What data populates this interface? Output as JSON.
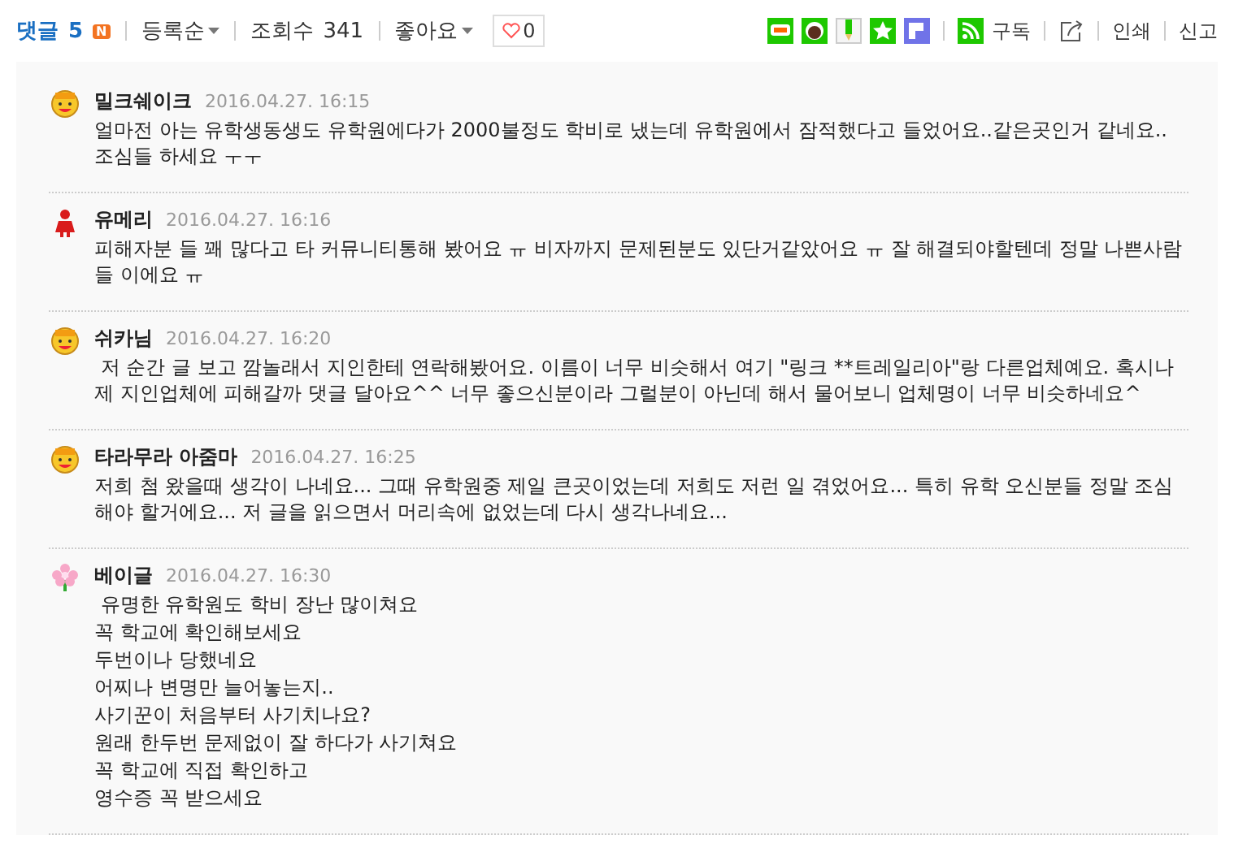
{
  "toolbar": {
    "comments_label": "댓글",
    "comments_count": "5",
    "new_badge": "N",
    "sort": "등록순",
    "views_label": "조회수",
    "views_count": "341",
    "likes_menu": "좋아요",
    "like_count": "0",
    "liked": false,
    "share_icons": [
      {
        "kind": "blog"
      },
      {
        "kind": "circle"
      },
      {
        "kind": "memo"
      },
      {
        "kind": "star"
      },
      {
        "kind": "pin"
      }
    ],
    "subscribe": "구독",
    "print": "인쇄",
    "report": "신고"
  },
  "comments": [
    {
      "kind": "face",
      "author": "밀크쉐이크",
      "date": "2016.04.27. 16:15",
      "lines": [
        "얼마전 아는 유학생동생도 유학원에다가 2000불정도 학비로 냈는데 유학원에서 잠적했다고 들었어요..같은곳인거 같네요.. 조심들 하세요 ㅜㅜ"
      ]
    },
    {
      "kind": "person",
      "author": "유메리",
      "date": "2016.04.27. 16:16",
      "lines": [
        "피해자분 들 꽤 많다고 타 커뮤니티통해 봤어요 ㅠ 비자까지 문제된분도 있단거같았어요 ㅠ 잘 해결되야할텐데 정말 나쁜사람들 이에요 ㅠ"
      ]
    },
    {
      "kind": "face",
      "author": "쉬카님",
      "date": "2016.04.27. 16:20",
      "lines": [
        " 저 순간 글 보고 깜놀래서 지인한테 연락해봤어요. 이름이 너무 비슷해서 여기 \"링크 **트레일리아\"랑 다른업체예요. 혹시나 제 지인업체에 피해갈까 댓글 달아요^^ 너무 좋으신분이라 그럴분이 아닌데 해서 물어보니 업체명이 너무 비슷하네요^"
      ]
    },
    {
      "kind": "face",
      "author": "타라무라 아줌마",
      "date": "2016.04.27. 16:25",
      "lines": [
        "저희 첨 왔을때 생각이 나네요... 그때 유학원중 제일 큰곳이었는데 저희도 저런 일 겪었어요... 특히 유학 오신분들 정말 조심해야 할거에요... 저 글을 읽으면서 머리속에 없었는데 다시 생각나네요..."
      ]
    },
    {
      "kind": "flower",
      "author": "베이글",
      "date": "2016.04.27. 16:30",
      "lines": [
        " 유명한 유학원도 학비 장난 많이쳐요",
        "꼭 학교에 확인해보세요",
        "두번이나 당했네요",
        "어찌나 변명만 늘어놓는지..",
        "사기꾼이 처음부터 사기치나요?",
        "원래 한두번 문제없이 잘 하다가 사기쳐요",
        "꼭 학교에 직접 확인하고",
        "영수증 꼭 받으세요"
      ]
    }
  ]
}
